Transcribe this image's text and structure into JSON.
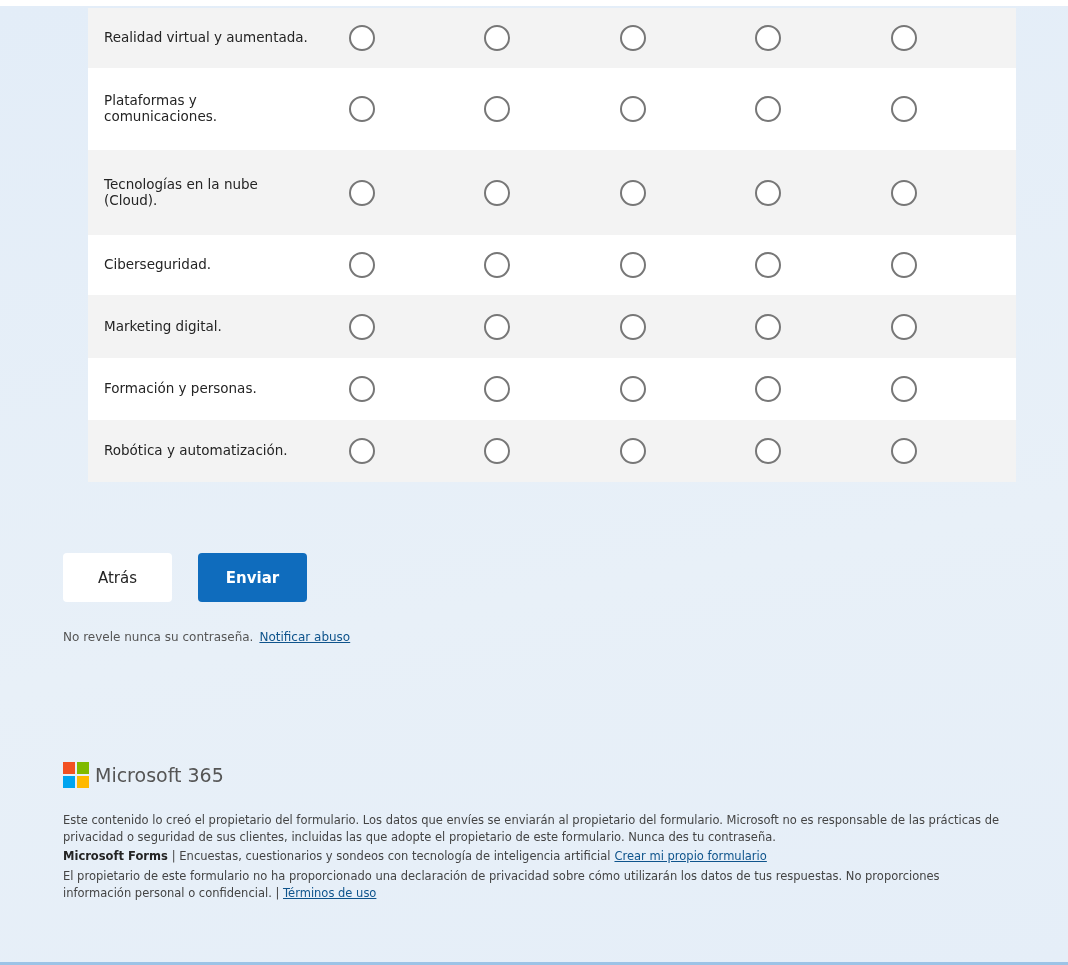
{
  "likert": {
    "rows": [
      {
        "label": "Realidad virtual y aumentada.",
        "choices": [
          {
            "selected": false
          },
          {
            "selected": false
          },
          {
            "selected": false
          },
          {
            "selected": false
          },
          {
            "selected": false
          }
        ]
      },
      {
        "label": "Plataformas y comunicaciones.",
        "choices": [
          {
            "selected": false
          },
          {
            "selected": false
          },
          {
            "selected": false
          },
          {
            "selected": false
          },
          {
            "selected": false
          }
        ]
      },
      {
        "label": "Tecnologías en la nube (Cloud).",
        "choices": [
          {
            "selected": false
          },
          {
            "selected": false
          },
          {
            "selected": false
          },
          {
            "selected": false
          },
          {
            "selected": false
          }
        ]
      },
      {
        "label": "Ciberseguridad.",
        "choices": [
          {
            "selected": false
          },
          {
            "selected": false
          },
          {
            "selected": false
          },
          {
            "selected": false
          },
          {
            "selected": false
          }
        ]
      },
      {
        "label": "Marketing digital.",
        "choices": [
          {
            "selected": false
          },
          {
            "selected": false
          },
          {
            "selected": false
          },
          {
            "selected": false
          },
          {
            "selected": false
          }
        ]
      },
      {
        "label": "Formación y personas.",
        "choices": [
          {
            "selected": false
          },
          {
            "selected": false
          },
          {
            "selected": false
          },
          {
            "selected": false
          },
          {
            "selected": false
          }
        ]
      },
      {
        "label": "Robótica y automatización.",
        "choices": [
          {
            "selected": false
          },
          {
            "selected": false
          },
          {
            "selected": false
          },
          {
            "selected": false
          },
          {
            "selected": false
          }
        ]
      }
    ]
  },
  "buttons": [
    {
      "label": "Atrás",
      "kind": "secondary"
    },
    {
      "label": "Enviar",
      "kind": "primary"
    }
  ],
  "password_notice": {
    "text": "No revele nunca su contraseña.",
    "link": "Notificar abuso"
  },
  "footer": {
    "brand": "Microsoft 365",
    "disclaimer": "Este contenido lo creó el propietario del formulario. Los datos que envíes se enviarán al propietario del formulario. Microsoft no es responsable de las prácticas de privacidad o seguridad de sus clientes, incluidas las que adopte el propietario de este formulario. Nunca des tu contraseña.",
    "product": "Microsoft Forms",
    "tagline": "| Encuestas, cuestionarios y sondeos con tecnología de inteligencia artificial",
    "create_link": "Crear mi propio formulario",
    "privacy": "El propietario de este formulario no ha proporcionado una declaración de privacidad sobre cómo utilizarán los datos de tus respuestas. No proporciones información personal o confidencial.",
    "separator": "|",
    "terms_link": "Términos de uso"
  }
}
